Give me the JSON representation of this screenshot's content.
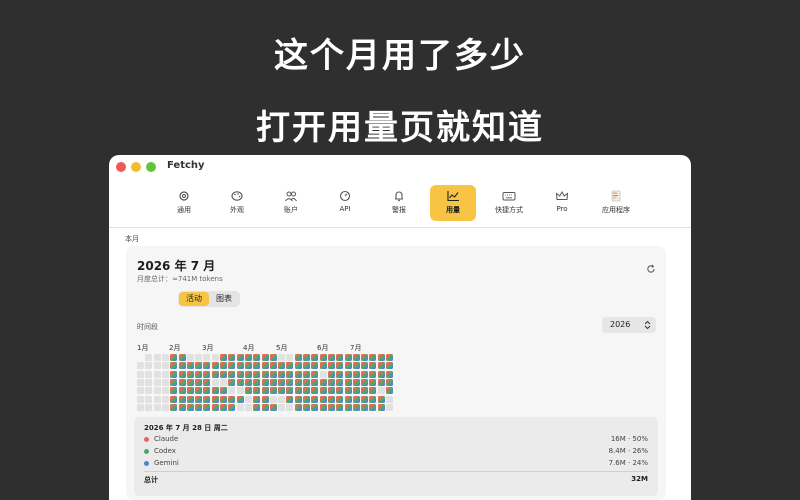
{
  "promo": {
    "line1": "这个月用了多少",
    "line2": "打开用量页就知道"
  },
  "window": {
    "title": "Fetchy"
  },
  "toolbar": {
    "items": [
      {
        "label": "通用",
        "icon": "gear-icon",
        "active": false
      },
      {
        "label": "外观",
        "icon": "palette-icon",
        "active": false
      },
      {
        "label": "账户",
        "icon": "users-icon",
        "active": false
      },
      {
        "label": "API",
        "icon": "gauge-icon",
        "active": false
      },
      {
        "label": "警报",
        "icon": "bell-icon",
        "active": false
      },
      {
        "label": "用量",
        "icon": "line-chart-icon",
        "active": true
      },
      {
        "label": "快捷方式",
        "icon": "keyboard-icon",
        "active": false
      },
      {
        "label": "Pro",
        "icon": "crown-icon",
        "active": false
      },
      {
        "label": "应用程序",
        "icon": "app-icon",
        "active": false
      }
    ]
  },
  "section_label": "本月",
  "card": {
    "month_title": "2026 年 7 月",
    "month_total": "月度总计：≈741M tokens",
    "segment": {
      "options": [
        "活动",
        "图表"
      ],
      "selected": "活动"
    },
    "period_label": "时间段",
    "year_select": "2026",
    "month_labels": [
      "1月",
      "2月",
      "3月",
      "4月",
      "5月",
      "6月",
      "7月"
    ],
    "details": {
      "date": "2026 年 7 月 28 日 周二",
      "rows": [
        {
          "name": "Claude",
          "value": "16M · 50%",
          "color": "#e06c5c"
        },
        {
          "name": "Codex",
          "value": "8.4M · 26%",
          "color": "#4fa66b"
        },
        {
          "name": "Gemini",
          "value": "7.6M · 24%",
          "color": "#5b7fd6"
        }
      ],
      "total_label": "总计",
      "total_value": "32M"
    }
  },
  "colors": {
    "accent": "#f7c543",
    "claude": "#e06c5c",
    "codex": "#4fa66b",
    "gemini": "#5b7fd6",
    "empty_cell": "#e1e1e1"
  }
}
